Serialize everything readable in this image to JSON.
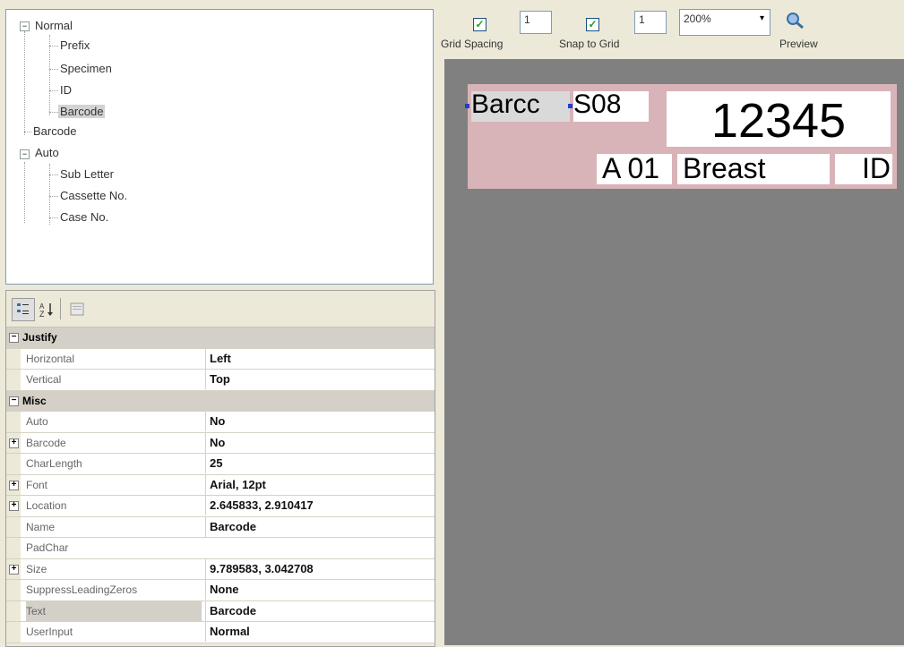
{
  "tree": {
    "normal": "Normal",
    "prefix": "Prefix",
    "specimen": "Specimen",
    "id": "ID",
    "barcode_child": "Barcode",
    "barcode": "Barcode",
    "auto": "Auto",
    "sub_letter": "Sub Letter",
    "cassette_no": "Cassette No.",
    "case_no": "Case No."
  },
  "property_grid": {
    "toolbar": {
      "categorized_icon": "categorized-icon",
      "alphabetical_icon": "alphabetical-icon",
      "property_pages_icon": "property-pages-icon"
    },
    "rows": [
      {
        "type": "category",
        "label": "Justify",
        "expand": "⊟"
      },
      {
        "type": "prop",
        "key": "Horizontal",
        "value": "Left"
      },
      {
        "type": "prop",
        "key": "Vertical",
        "value": "Top"
      },
      {
        "type": "category",
        "label": "Misc",
        "expand": "⊟"
      },
      {
        "type": "prop",
        "key": "Auto",
        "value": "No"
      },
      {
        "type": "prop",
        "key": "Barcode",
        "value": "No",
        "expand": "+"
      },
      {
        "type": "prop",
        "key": "CharLength",
        "value": "25"
      },
      {
        "type": "prop",
        "key": "Font",
        "value": "Arial, 12pt",
        "expand": "+"
      },
      {
        "type": "prop",
        "key": "Location",
        "value": "2.645833, 2.910417",
        "expand": "+"
      },
      {
        "type": "prop",
        "key": "Name",
        "value": "Barcode"
      },
      {
        "type": "prop",
        "key": "PadChar",
        "value": ""
      },
      {
        "type": "prop",
        "key": "Size",
        "value": "9.789583, 3.042708",
        "expand": "+"
      },
      {
        "type": "prop",
        "key": "SuppressLeadingZeros",
        "value": "None"
      },
      {
        "type": "prop",
        "key": "Text",
        "value": "Barcode",
        "selected": true
      },
      {
        "type": "prop",
        "key": "UserInput",
        "value": "Normal"
      }
    ]
  },
  "toolbar": {
    "grid_spacing_label": "Grid Spacing",
    "grid_spacing_value": "1",
    "snap_label": "Snap to Grid",
    "snap_value": "1",
    "zoom": "200%",
    "preview_label": "Preview",
    "checkmark": "✓",
    "dropdown_arrow": "▾"
  },
  "label": {
    "barcode_text": "Barcc",
    "s08": "S08",
    "case_number": "12345",
    "a01": "A 01",
    "specimen": "Breast",
    "id": "ID"
  },
  "colors": {
    "label_background": "#d8b3b8",
    "canvas_background": "#808080",
    "selection_handle": "#1f3fd0"
  }
}
